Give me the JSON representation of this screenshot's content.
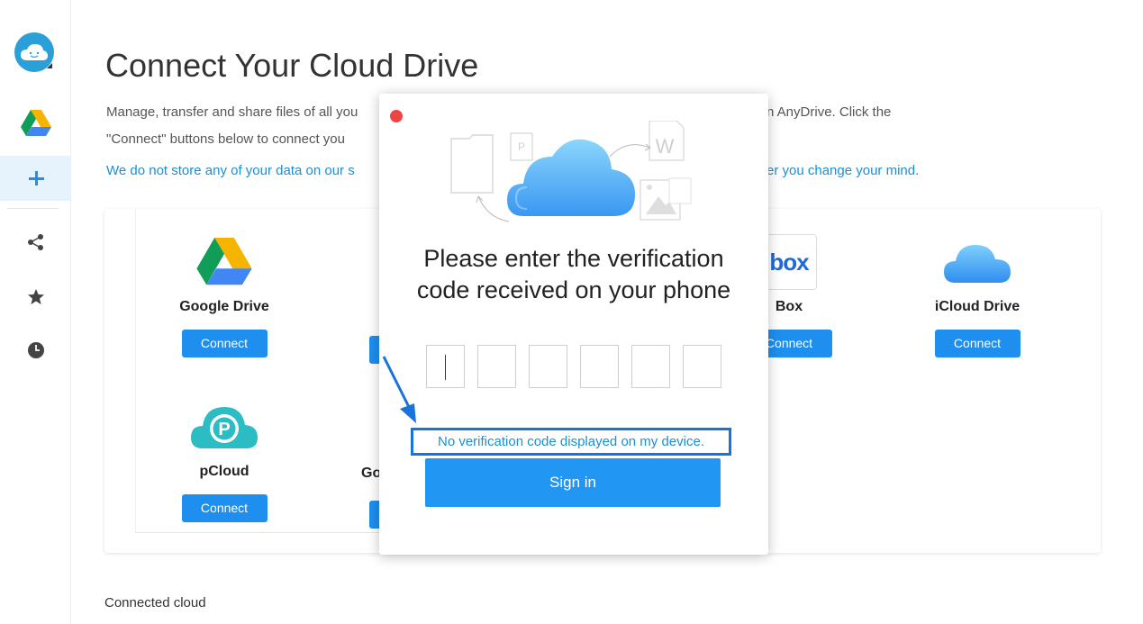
{
  "page": {
    "title": "Connect Your Cloud Drive",
    "description_line1": "Manage, transfer and share files of all you",
    "description_line1_tail": "n AnyDrive. Click the",
    "description_line2": "\"Connect\" buttons below to connect you",
    "notice_left": "We do not store any of your data on our s",
    "notice_right": "er you change your mind.",
    "connected_cloud_label": "Connected cloud"
  },
  "sidebar": {
    "items": [
      {
        "icon": "google-drive-icon"
      },
      {
        "icon": "plus-icon",
        "active": true
      },
      {
        "icon": "share-icon"
      },
      {
        "icon": "star-icon"
      },
      {
        "icon": "clock-icon"
      }
    ]
  },
  "clouds": [
    {
      "name": "Google Drive",
      "connect": "Connect"
    },
    {
      "name": "Box",
      "connect": "Connect"
    },
    {
      "name": "iCloud Drive",
      "connect": "Connect"
    },
    {
      "name": "pCloud",
      "connect": "Connect"
    },
    {
      "name_partial": "Go"
    }
  ],
  "box_logo_text": "box",
  "modal": {
    "heading_line1": "Please enter the verification",
    "heading_line2": "code received on your phone",
    "no_code_link": "No verification code displayed on my device.",
    "sign_in": "Sign in",
    "code_boxes": 6
  },
  "colors": {
    "accent": "#1e8fee",
    "link": "#1a8fd8",
    "highlight_border": "#1a73d9"
  }
}
